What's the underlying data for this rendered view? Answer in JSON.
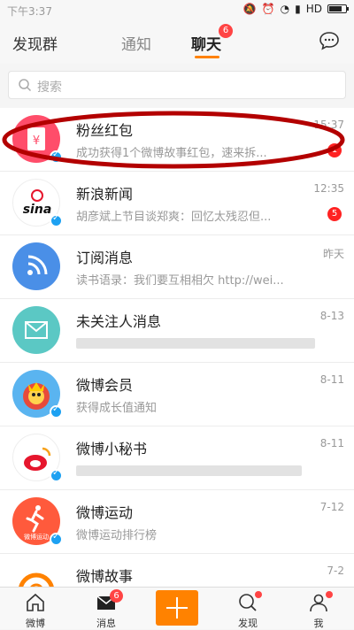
{
  "status_bar": {
    "time": "下午3:37",
    "network": "HD"
  },
  "header": {
    "left_label": "发现群",
    "tabs": [
      {
        "label": "通知"
      },
      {
        "label": "聊天",
        "badge": "6"
      }
    ]
  },
  "search": {
    "placeholder": "搜索"
  },
  "chats": [
    {
      "name": "粉丝红包",
      "preview": "成功获得1个微博故事红包，速来拆...",
      "time": "15:37",
      "badge": "1"
    },
    {
      "name": "新浪新闻",
      "preview": "胡彦斌上节目谈郑爽：回忆太残忍但...",
      "time": "12:35",
      "badge": "5"
    },
    {
      "name": "订阅消息",
      "preview": "读书语录：我们要互相相欠 http://wei...",
      "time": "昨天"
    },
    {
      "name": "未关注人消息",
      "preview": "",
      "time": "8-13"
    },
    {
      "name": "微博会员",
      "preview": "获得成长值通知",
      "time": "8-11"
    },
    {
      "name": "微博小秘书",
      "preview": "",
      "time": "8-11"
    },
    {
      "name": "微博运动",
      "preview": "微博运动排行榜",
      "time": "7-12",
      "avatar_text": "微博运动"
    },
    {
      "name": "微博故事",
      "preview": "",
      "time": "7-2"
    }
  ],
  "bottom_nav": {
    "home": "微博",
    "messages": "消息",
    "messages_badge": "6",
    "discover": "发现",
    "me": "我"
  },
  "colors": {
    "accent": "#ff8200",
    "badge": "#ff2222",
    "annotation": "#b30000"
  }
}
